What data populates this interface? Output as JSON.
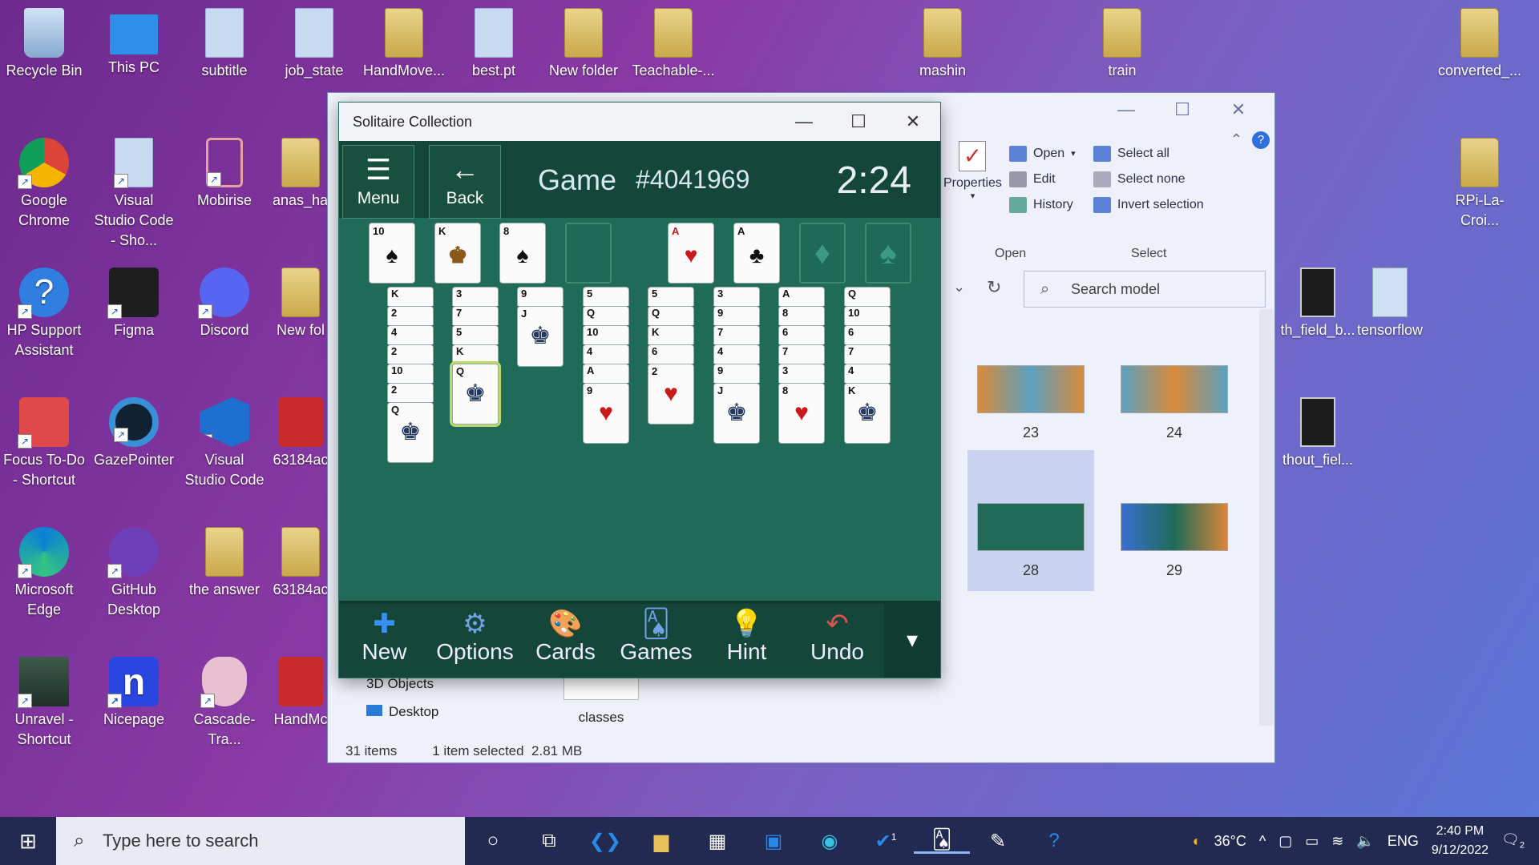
{
  "desktop": {
    "icons": [
      {
        "label": "Recycle Bin",
        "icon": "recycle-bin-icon"
      },
      {
        "label": "This PC",
        "icon": "computer-icon"
      },
      {
        "label": "subtitle",
        "icon": "python-file-icon"
      },
      {
        "label": "job_state",
        "icon": "file-icon"
      },
      {
        "label": "HandMove...",
        "icon": "folder-icon"
      },
      {
        "label": "best.pt",
        "icon": "file-icon"
      },
      {
        "label": "New folder",
        "icon": "folder-icon"
      },
      {
        "label": "Teachable-...",
        "icon": "folder-icon"
      },
      {
        "label": "mashin",
        "icon": "folder-icon"
      },
      {
        "label": "train",
        "icon": "folder-icon"
      },
      {
        "label": "converted_...",
        "icon": "folder-icon"
      },
      {
        "label": "Google Chrome",
        "icon": "chrome-icon"
      },
      {
        "label": "Visual Studio Code - Sho...",
        "icon": "file-icon"
      },
      {
        "label": "Mobirise",
        "icon": "mobirise-icon"
      },
      {
        "label": "anas_haa",
        "icon": "folder-icon"
      },
      {
        "label": "RPi-La-Croi...",
        "icon": "folder-icon"
      },
      {
        "label": "HP Support Assistant",
        "icon": "help-icon"
      },
      {
        "label": "Figma",
        "icon": "figma-icon"
      },
      {
        "label": "Discord",
        "icon": "discord-icon"
      },
      {
        "label": "New fol",
        "icon": "folder-icon"
      },
      {
        "label": "th_field_b...",
        "icon": "folder-icon"
      },
      {
        "label": "tensorflow",
        "icon": "folder-icon"
      },
      {
        "label": "Focus To-Do - Shortcut",
        "icon": "focus-todo-icon"
      },
      {
        "label": "GazePointer",
        "icon": "eye-icon"
      },
      {
        "label": "Visual Studio Code",
        "icon": "vscode-icon"
      },
      {
        "label": "63184ac",
        "icon": "zip-icon"
      },
      {
        "label": "thout_fiel...",
        "icon": "folder-icon"
      },
      {
        "label": "Microsoft Edge",
        "icon": "edge-icon"
      },
      {
        "label": "GitHub Desktop",
        "icon": "github-icon"
      },
      {
        "label": "the answer",
        "icon": "folder-icon"
      },
      {
        "label": "63184ac",
        "icon": "folder-icon"
      },
      {
        "label": "Unravel - Shortcut",
        "icon": "game-icon"
      },
      {
        "label": "Nicepage",
        "icon": "nicepage-icon"
      },
      {
        "label": "Cascade-Tra...",
        "icon": "folder-icon"
      },
      {
        "label": "HandMc",
        "icon": "zip-icon"
      }
    ]
  },
  "explorer": {
    "ribbon": {
      "properties": "Properties",
      "open": "Open",
      "edit": "Edit",
      "history": "History",
      "open_group": "Open",
      "select_all": "Select all",
      "select_none": "Select none",
      "invert_selection": "Invert selection",
      "select_group": "Select"
    },
    "search_placeholder": "Search model",
    "thumbs": [
      {
        "label": "23"
      },
      {
        "label": "24"
      },
      {
        "label": "28"
      },
      {
        "label": "29"
      }
    ],
    "nav": [
      "3D Objects",
      "Desktop"
    ],
    "file_label": "classes",
    "status": {
      "items": "31 items",
      "selected": "1 item selected",
      "size": "2.81 MB"
    }
  },
  "solitaire": {
    "title": "Solitaire Collection",
    "menu": "Menu",
    "back": "Back",
    "game_label": "Game",
    "game_number": "#4041969",
    "timer": "2:24",
    "toolbar": {
      "new": "New",
      "options": "Options",
      "cards": "Cards",
      "games": "Games",
      "hint": "Hint",
      "undo": "Undo"
    },
    "stock": [
      "10",
      "K",
      "8"
    ],
    "foundations": [
      "A",
      "A",
      "",
      ""
    ],
    "tableau": [
      [
        "K",
        "2",
        "4",
        "2",
        "10",
        "2",
        "Q"
      ],
      [
        "3",
        "7",
        "5",
        "K",
        "Q"
      ],
      [
        "9",
        "J"
      ],
      [
        "5",
        "Q",
        "10",
        "4",
        "A",
        "9"
      ],
      [
        "5",
        "Q",
        "K",
        "6",
        "2"
      ],
      [
        "3",
        "9",
        "7",
        "4",
        "9",
        "J"
      ],
      [
        "A",
        "8",
        "6",
        "7",
        "3",
        "8"
      ],
      [
        "Q",
        "10",
        "6",
        "7",
        "4",
        "K"
      ]
    ]
  },
  "taskbar": {
    "search_placeholder": "Type here to search",
    "weather": "36°C",
    "language": "ENG",
    "time": "2:40 PM",
    "date": "9/12/2022",
    "badge_todo": "1",
    "notif_count": "2"
  },
  "colors": {
    "felt": "#1f6b58",
    "bar": "#14463a",
    "taskbar": "#222a52"
  }
}
